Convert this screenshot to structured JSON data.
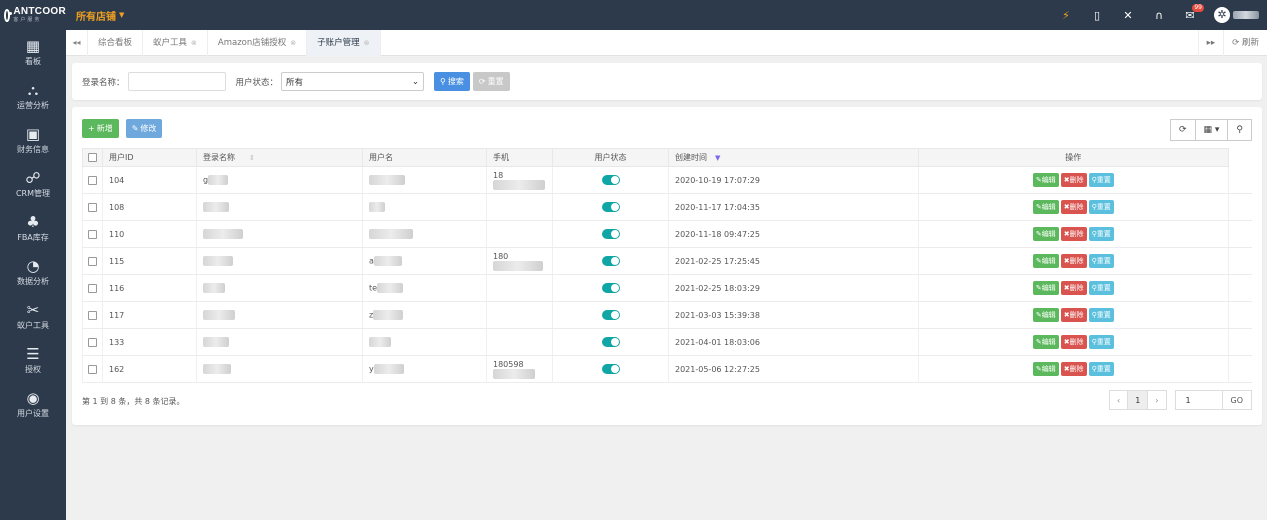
{
  "brand": {
    "logo": "ANTCOOR",
    "sub": "客户服务",
    "shop": "所有店铺"
  },
  "top_icons": [
    {
      "name": "plug-icon",
      "glyph": "⚡"
    },
    {
      "name": "phone-icon",
      "glyph": "▯"
    },
    {
      "name": "expand-icon",
      "glyph": "✕"
    },
    {
      "name": "headset-icon",
      "glyph": "∩"
    },
    {
      "name": "mail-icon",
      "glyph": "✉",
      "badge": "99"
    }
  ],
  "sidebar": [
    {
      "icon": "▦",
      "label": "看板"
    },
    {
      "icon": "⛬",
      "label": "运营分析"
    },
    {
      "icon": "▣",
      "label": "财务信息"
    },
    {
      "icon": "☍",
      "label": "CRM管理"
    },
    {
      "icon": "♣",
      "label": "FBA库存"
    },
    {
      "icon": "◔",
      "label": "数据分析"
    },
    {
      "icon": "✂",
      "label": "蚁户工具"
    },
    {
      "icon": "☰",
      "label": "授权"
    },
    {
      "icon": "◉",
      "label": "用户设置"
    }
  ],
  "tabs": [
    {
      "label": "综合看板",
      "closable": false
    },
    {
      "label": "蚁户工具",
      "closable": true
    },
    {
      "label": "Amazon店铺授权",
      "closable": true
    },
    {
      "label": "子账户管理",
      "closable": true,
      "active": true
    }
  ],
  "tabs_right": {
    "forward": "▸▸",
    "refresh": "⟳ 刷新"
  },
  "filter": {
    "login_label": "登录名称：",
    "login_value": "",
    "status_label": "用户状态：",
    "status_value": "所有",
    "search_btn": "搜索",
    "reset_btn": "重置"
  },
  "actions": {
    "add": "新增",
    "edit": "修改"
  },
  "table": {
    "headers": [
      "用户ID",
      "登录名称",
      "用户名",
      "手机",
      "用户状态",
      "创建时间",
      "操作"
    ],
    "op_labels": {
      "edit": "编辑",
      "delete": "删除",
      "reset": "重置"
    },
    "rows": [
      {
        "id": "104",
        "login": "g",
        "name": "",
        "phone": "18",
        "created": "2020-10-19 17:07:29"
      },
      {
        "id": "108",
        "login": "",
        "name": "",
        "phone": "",
        "created": "2020-11-17 17:04:35"
      },
      {
        "id": "110",
        "login": "",
        "name": "",
        "phone": "",
        "created": "2020-11-18 09:47:25"
      },
      {
        "id": "115",
        "login": "",
        "name": "a",
        "phone": "180",
        "created": "2021-02-25 17:25:45"
      },
      {
        "id": "116",
        "login": "",
        "name": "te",
        "phone": "",
        "created": "2021-02-25 18:03:29"
      },
      {
        "id": "117",
        "login": "",
        "name": "z",
        "phone": "",
        "created": "2021-03-03 15:39:38"
      },
      {
        "id": "133",
        "login": "",
        "name": "",
        "phone": "",
        "created": "2021-04-01 18:03:06"
      },
      {
        "id": "162",
        "login": "",
        "name": "y",
        "phone": "180598",
        "created": "2021-05-06 12:27:25"
      }
    ]
  },
  "footer": {
    "summary": "第 1 到 8 条，共 8 条记录。",
    "prev": "‹",
    "page": "1",
    "next": "›",
    "goto_value": "1",
    "go": "GO"
  },
  "colors": {
    "topbar": "#2d3a4b",
    "accent": "#f0a020",
    "toggle": "#11a6a6",
    "primary": "#4a90e2"
  }
}
